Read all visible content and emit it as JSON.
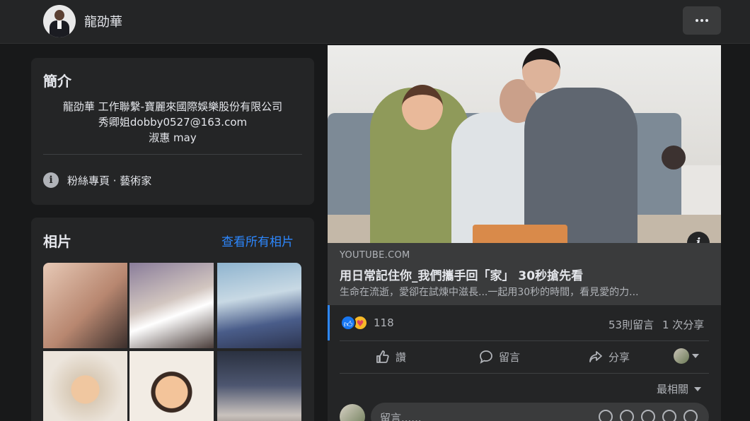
{
  "header": {
    "page_name": "龍劭華",
    "avatar_icon": "profile-photo",
    "more_label": "more-options-icon"
  },
  "intro": {
    "title": "簡介",
    "bio_lines": [
      "龍劭華 工作聯繫-寶麗來國際娛樂股份有限公司",
      "秀卿姐dobby0527@163.com",
      "淑惠 may"
    ],
    "info_icon": "info-icon",
    "category": "粉絲專頁 · 藝術家"
  },
  "photos": {
    "title": "相片",
    "see_all": "查看所有相片"
  },
  "post": {
    "info_badge": "i",
    "link": {
      "domain": "YOUTUBE.COM",
      "title": "用日常記住你_我們攜手回「家」 30秒搶先看",
      "description": "生命在流逝，愛卻在試煉中滋長...一起用30秒的時間，看見愛的力..."
    },
    "reactions": {
      "icons": [
        "like-reaction-icon",
        "care-reaction-icon"
      ],
      "count": "118"
    },
    "comment_count": "53則留言",
    "share_count": "1 次分享",
    "actions": {
      "like": "讚",
      "comment": "留言",
      "share": "分享"
    },
    "sort_label": "最相關",
    "comment_placeholder": "留言......",
    "accent_color": "#2d88ff"
  }
}
